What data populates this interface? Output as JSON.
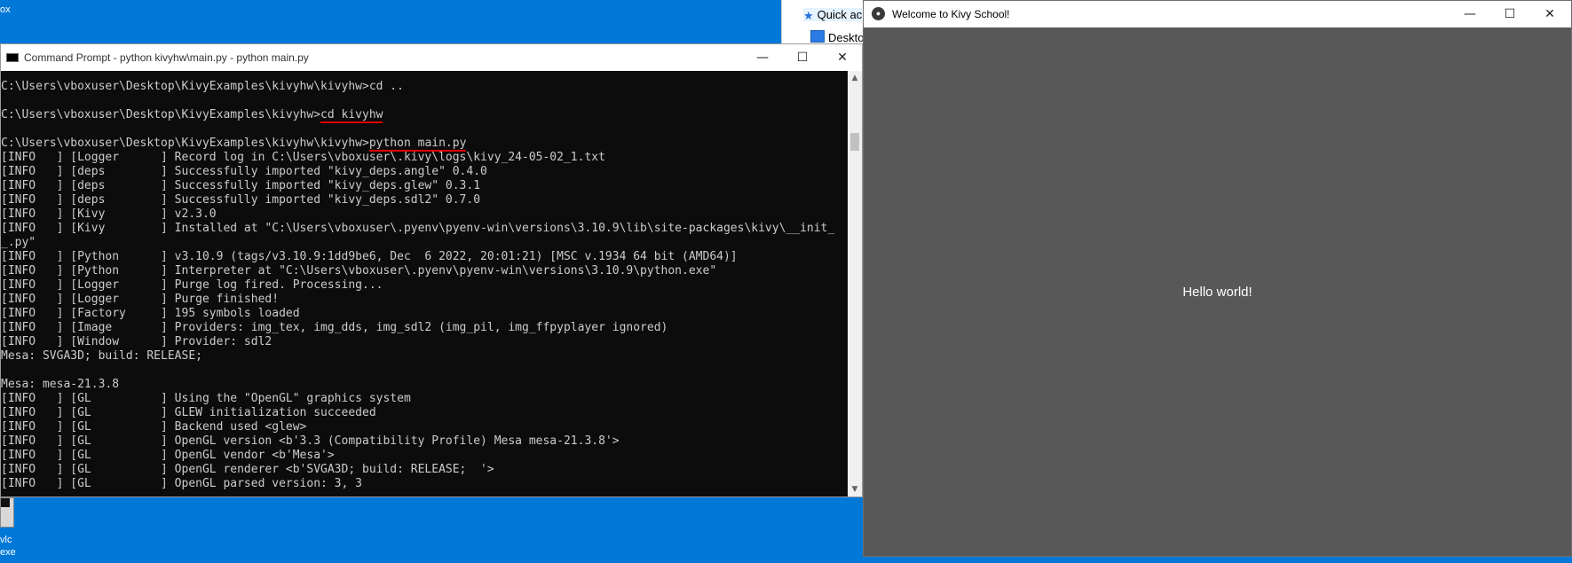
{
  "desktop": {
    "top_left_text": "ox",
    "icon_label_1": "vlc",
    "icon_label_2": "exe"
  },
  "explorer": {
    "quick_access": "Quick ac",
    "desktop_item": "Desktop"
  },
  "cmd": {
    "title": "Command Prompt - python  kivyhw\\main.py - python  main.py",
    "minimize": "—",
    "maximize": "☐",
    "close": "✕",
    "lines": [
      "C:\\Users\\vboxuser\\Desktop\\KivyExamples\\kivyhw\\kivyhw>cd ..",
      "",
      "C:\\Users\\vboxuser\\Desktop\\KivyExamples\\kivyhw>cd kivyhw",
      "",
      "C:\\Users\\vboxuser\\Desktop\\KivyExamples\\kivyhw\\kivyhw>python main.py",
      "[INFO   ] [Logger      ] Record log in C:\\Users\\vboxuser\\.kivy\\logs\\kivy_24-05-02_1.txt",
      "[INFO   ] [deps        ] Successfully imported \"kivy_deps.angle\" 0.4.0",
      "[INFO   ] [deps        ] Successfully imported \"kivy_deps.glew\" 0.3.1",
      "[INFO   ] [deps        ] Successfully imported \"kivy_deps.sdl2\" 0.7.0",
      "[INFO   ] [Kivy        ] v2.3.0",
      "[INFO   ] [Kivy        ] Installed at \"C:\\Users\\vboxuser\\.pyenv\\pyenv-win\\versions\\3.10.9\\lib\\site-packages\\kivy\\__init_",
      "_.py\"",
      "[INFO   ] [Python      ] v3.10.9 (tags/v3.10.9:1dd9be6, Dec  6 2022, 20:01:21) [MSC v.1934 64 bit (AMD64)]",
      "[INFO   ] [Python      ] Interpreter at \"C:\\Users\\vboxuser\\.pyenv\\pyenv-win\\versions\\3.10.9\\python.exe\"",
      "[INFO   ] [Logger      ] Purge log fired. Processing...",
      "[INFO   ] [Logger      ] Purge finished!",
      "[INFO   ] [Factory     ] 195 symbols loaded",
      "[INFO   ] [Image       ] Providers: img_tex, img_dds, img_sdl2 (img_pil, img_ffpyplayer ignored)",
      "[INFO   ] [Window      ] Provider: sdl2",
      "Mesa: SVGA3D; build: RELEASE;",
      "",
      "Mesa: mesa-21.3.8",
      "[INFO   ] [GL          ] Using the \"OpenGL\" graphics system",
      "[INFO   ] [GL          ] GLEW initialization succeeded",
      "[INFO   ] [GL          ] Backend used <glew>",
      "[INFO   ] [GL          ] OpenGL version <b'3.3 (Compatibility Profile) Mesa mesa-21.3.8'>",
      "[INFO   ] [GL          ] OpenGL vendor <b'Mesa'>",
      "[INFO   ] [GL          ] OpenGL renderer <b'SVGA3D; build: RELEASE;  '>",
      "[INFO   ] [GL          ] OpenGL parsed version: 3, 3"
    ],
    "highlights": [
      {
        "line": 2,
        "text": "cd kivyhw"
      },
      {
        "line": 4,
        "text": "python main.py"
      }
    ],
    "highlight_color": "#e00000",
    "text_color": "#cccccc",
    "background_color": "#0c0c0c"
  },
  "kivy": {
    "title": "Welcome to Kivy School!",
    "app_icon": "kivy-logo-icon",
    "minimize": "—",
    "maximize": "☐",
    "close": "✕",
    "label": "Hello world!",
    "background_color": "#585858"
  }
}
